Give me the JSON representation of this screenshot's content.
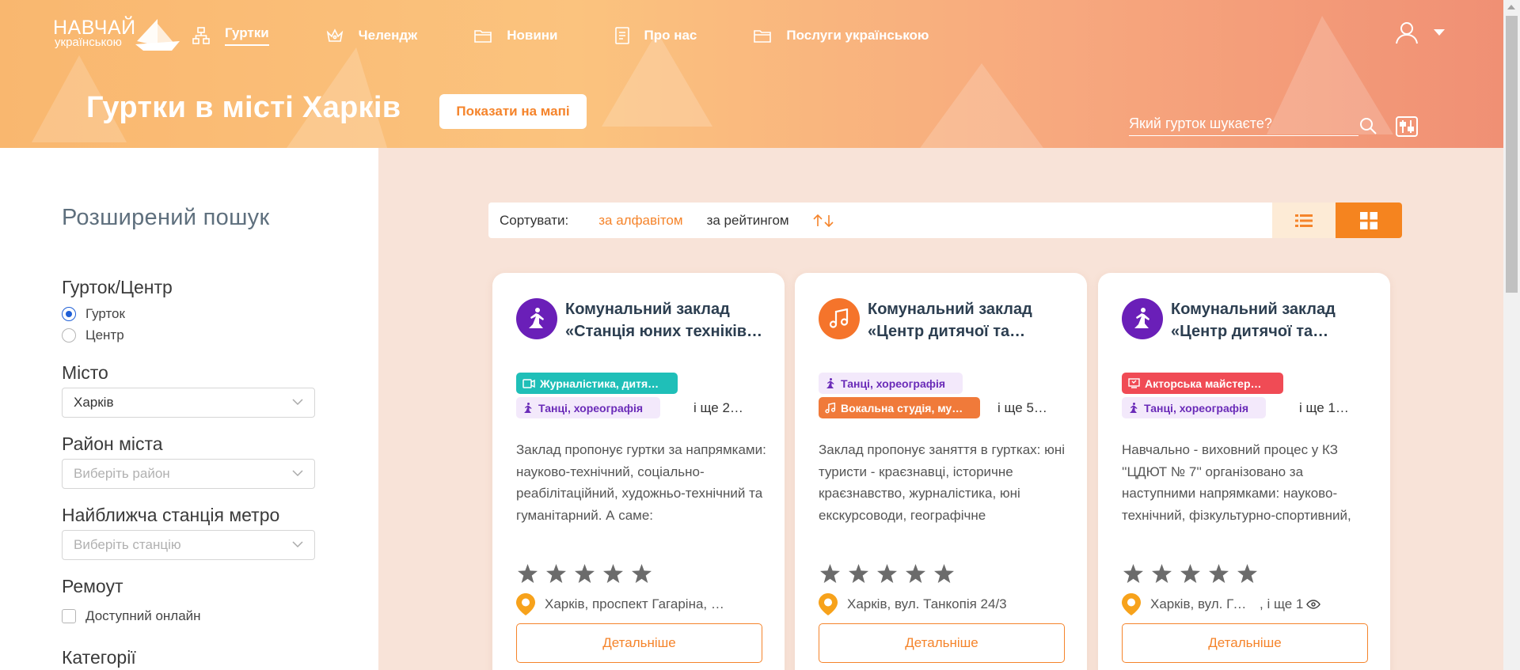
{
  "header": {
    "logo_word": "НАВЧАЙ",
    "logo_sub": "українською",
    "nav": [
      {
        "label": "Гуртки",
        "icon": "hierarchy-icon",
        "active": true
      },
      {
        "label": "Челендж",
        "icon": "crown-icon",
        "active": false
      },
      {
        "label": "Новини",
        "icon": "folder-icon",
        "active": false
      },
      {
        "label": "Про нас",
        "icon": "document-icon",
        "active": false
      },
      {
        "label": "Послуги українською",
        "icon": "folder-icon",
        "active": false
      }
    ],
    "title": "Гуртки в місті Харків",
    "map_button": "Показати на мапі",
    "search_placeholder": "Який гурток шукаєте?"
  },
  "sidebar": {
    "title": "Розширений пошук",
    "type_label": "Гурток/Центр",
    "type_options": [
      {
        "label": "Гурток",
        "checked": true
      },
      {
        "label": "Центр",
        "checked": false
      }
    ],
    "city_label": "Місто",
    "city_value": "Харків",
    "district_label": "Район міста",
    "district_placeholder": "Виберіть район",
    "metro_label": "Найближча станція метро",
    "metro_placeholder": "Виберіть станцію",
    "remote_label": "Ремоут",
    "online_label": "Доступний онлайн",
    "categories_label": "Категорії"
  },
  "sort": {
    "label": "Сортувати:",
    "options": [
      "за алфавітом",
      "за рейтингом"
    ],
    "active": "за алфавітом"
  },
  "colors": {
    "accent": "#f5842b",
    "teal": "#1fbfb8",
    "purple_bg": "#f2e8fb",
    "purple": "#6a2bb8",
    "orange_tag": "#f07a3a",
    "red_tag": "#f04b55"
  },
  "cards": [
    {
      "title_line1": "Комунальний заклад",
      "title_line2": "«Станція юних техніків…",
      "avatar_color": "#6a1fb8",
      "avatar_icon": "dance-icon",
      "tags": [
        {
          "label": "Журналістика, дитя…",
          "icon": "video-icon",
          "style": "teal"
        },
        {
          "label": "Танці, хореографія",
          "icon": "dance-icon",
          "style": "purple"
        }
      ],
      "more": "і ще 2…",
      "description": "Заклад пропонує гуртки за напрямками: науково-технічний, соціально-реабілітаційний, художньо-технічний та гуманітарний. А саме: Судномоделювання, Моя майбутня…",
      "rating": 0,
      "address": "Харків, проспект Гагаріна, …",
      "address_more": "",
      "button": "Детальніше"
    },
    {
      "title_line1": "Комунальний заклад",
      "title_line2": "«Центр дитячої та…",
      "avatar_color": "#f5742b",
      "avatar_icon": "music-note-icon",
      "tags": [
        {
          "label": "Танці, хореографія",
          "icon": "dance-icon",
          "style": "purple"
        },
        {
          "label": "Вокальна студія, му…",
          "icon": "music-note-icon",
          "style": "orange"
        }
      ],
      "more": "і ще 5…",
      "description": "Заклад пропонує заняття в гуртках: юні туристи - краєзнавці, історичне краєзнавство, журналістика, юні екскурсоводи, географічне краєзнавство, людина і довкілля,…",
      "rating": 0,
      "address": "Харків, вул. Танкопія 24/3",
      "address_more": "",
      "button": "Детальніше"
    },
    {
      "title_line1": "Комунальний заклад",
      "title_line2": "«Центр дитячої та…",
      "avatar_color": "#6a1fb8",
      "avatar_icon": "dance-icon",
      "tags": [
        {
          "label": "Акторська майстер…",
          "icon": "theater-icon",
          "style": "red"
        },
        {
          "label": "Танці, хореографія",
          "icon": "dance-icon",
          "style": "purple"
        }
      ],
      "more": "і ще 1…",
      "description": "Навчально - виховний процес у КЗ ''ЦДЮТ № 7'' організовано за наступними напрямками: науково-технічний, фізкультурно-спортивний, військово-патріотичний, художньо-…",
      "rating": 0,
      "address": "Харків, вул. Грозн…",
      "address_more": ", і ще 1",
      "button": "Детальніше"
    }
  ]
}
